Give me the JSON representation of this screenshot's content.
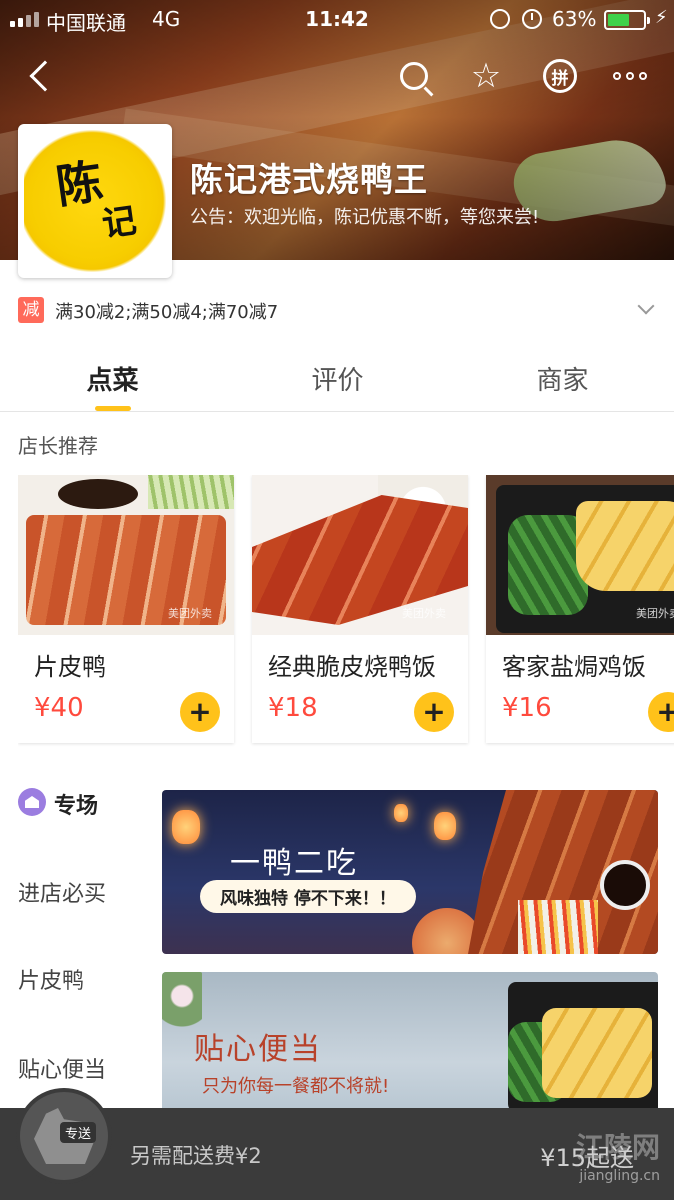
{
  "status": {
    "carrier": "中国联通",
    "network": "4G",
    "time": "11:42",
    "battery": "63%",
    "battery_level": 0.63
  },
  "shop": {
    "name": "陈记港式烧鸭王",
    "notice": "公告：欢迎光临，陈记优惠不断，等您来尝!",
    "logo_text_top": "陈",
    "logo_text_bottom": "记"
  },
  "nav": {
    "group_label": "拼"
  },
  "promo": {
    "tag": "减",
    "text": "满30减2;满50减4;满70减7"
  },
  "tabs": [
    {
      "label": "点菜"
    },
    {
      "label": "评价"
    },
    {
      "label": "商家"
    }
  ],
  "recommend": {
    "title": "店长推荐",
    "items": [
      {
        "name": "片皮鸭",
        "price": "¥40"
      },
      {
        "name": "经典脆皮烧鸭饭",
        "price": "¥18"
      },
      {
        "name": "客家盐焗鸡饭",
        "price": "¥16"
      }
    ],
    "watermark": "美团外卖",
    "add_label": "+"
  },
  "categories": [
    {
      "label": "专场"
    },
    {
      "label": "进店必买"
    },
    {
      "label": "片皮鸭"
    },
    {
      "label": "贴心便当"
    }
  ],
  "banners": [
    {
      "title": "一鸭二吃",
      "subtitle": "风味独特  停不下来！！"
    },
    {
      "title": "贴心便当",
      "subtitle": "只为你每一餐都不将就!"
    }
  ],
  "cart": {
    "badge": "专送",
    "delivery_fee": "另需配送费¥2",
    "min_order": "¥15起送"
  },
  "watermark_site": {
    "name": "江陵网",
    "url": "jiangling.cn"
  },
  "colors": {
    "accent": "#ffc21a",
    "price": "#ff4a3d",
    "promo_tag": "#ff6a5a",
    "cart_bar": "#3b3b3b"
  }
}
